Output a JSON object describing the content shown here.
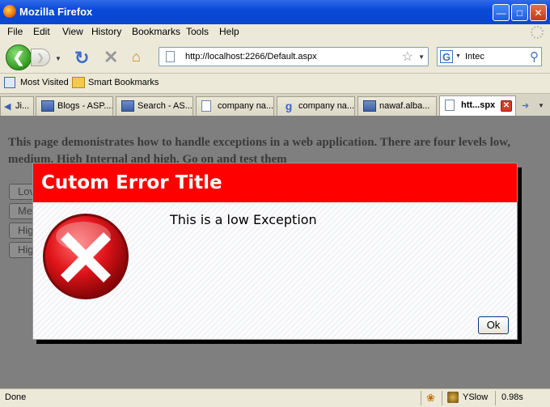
{
  "window": {
    "title": "Mozilla Firefox"
  },
  "menu": [
    "File",
    "Edit",
    "View",
    "History",
    "Bookmarks",
    "Tools",
    "Help"
  ],
  "nav": {
    "url": "http://localhost:2266/Default.aspx",
    "search_value": "Intec",
    "search_engine": "G"
  },
  "bookmarks": [
    "Most Visited",
    "Smart Bookmarks"
  ],
  "tabs": [
    {
      "label": "Ji...",
      "icon": "arrow-left-icon"
    },
    {
      "label": "Blogs - ASP....",
      "icon": "aspnet-icon"
    },
    {
      "label": "Search - AS...",
      "icon": "aspnet-icon"
    },
    {
      "label": "company na...",
      "icon": "page-icon"
    },
    {
      "label": "company na...",
      "icon": "google-icon"
    },
    {
      "label": "nawaf.alba...",
      "icon": "aspnet-icon"
    },
    {
      "label": "htt...spx",
      "icon": "page-icon",
      "active": true
    }
  ],
  "page": {
    "intro": "This page demonistrates how to handle exceptions in a web application. There are four levels low, medium, High Internal and high. Go on and test them",
    "buttons": [
      "Lov",
      "Me",
      "Hig",
      "Hig"
    ]
  },
  "modal": {
    "title": "Cutom Error Title",
    "message": "This is a low Exception",
    "ok_label": "Ok",
    "header_color": "#ff0000"
  },
  "status": {
    "text": "Done",
    "yslow": "YSlow",
    "time": "0.98s"
  }
}
